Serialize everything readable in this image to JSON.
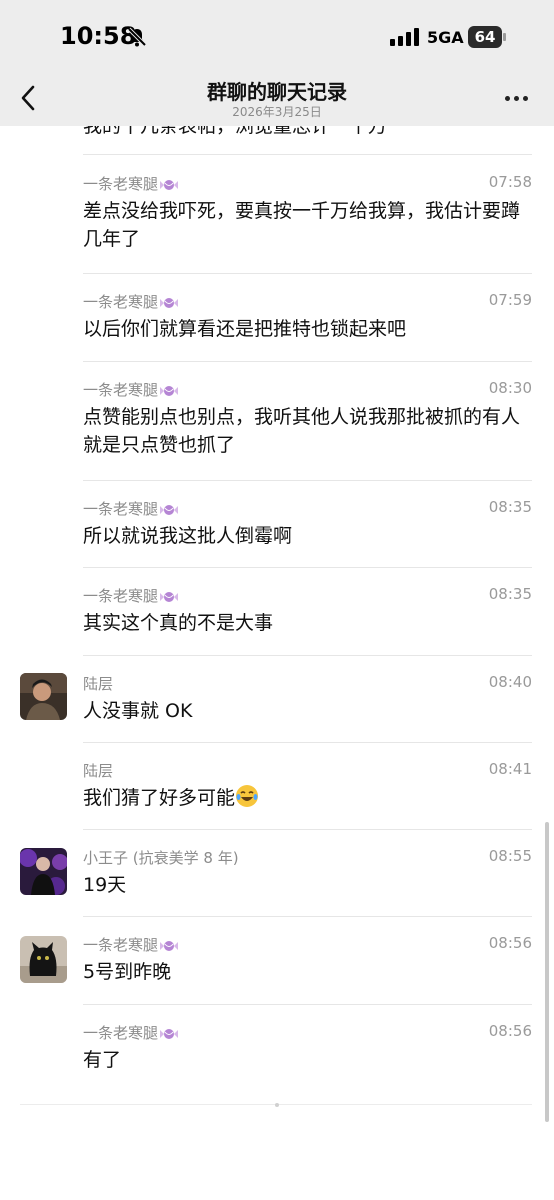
{
  "status_bar": {
    "time": "10:58",
    "network": "5GA",
    "battery": "64",
    "icons": [
      "bell-muted-icon",
      "signal-icon",
      "battery-icon"
    ]
  },
  "header": {
    "back_icon": "chevron-left-icon",
    "title": "群聊的聊天记录",
    "date": "2026年3月25日",
    "more_icon": "more-dots-icon"
  },
  "partial_top_text": "我的十几条表帖，浏览量总计一千万",
  "messages": [
    {
      "sender": "一条老寒腿",
      "time": "07:58",
      "text": "差点没给我吓死，要真按一千万给我算，我估计要蹲几年了",
      "avatar": ""
    },
    {
      "sender": "一条老寒腿",
      "time": "07:59",
      "text": "以后你们就算看还是把推特也锁起来吧",
      "avatar": ""
    },
    {
      "sender": "一条老寒腿",
      "time": "08:30",
      "text": "点赞能别点也别点，我听其他人说我那批被抓的有人就是只点赞也抓了",
      "avatar": ""
    },
    {
      "sender": "一条老寒腿",
      "time": "08:35",
      "text": "所以就说我这批人倒霉啊",
      "avatar": ""
    },
    {
      "sender": "一条老寒腿",
      "time": "08:35",
      "text": "其实这个真的不是大事",
      "avatar": ""
    },
    {
      "sender": "陆层",
      "time": "08:40",
      "text": "人没事就 OK",
      "avatar": "avatar-man-photo"
    },
    {
      "sender": "陆层",
      "time": "08:41",
      "text": "我们猜了好多可能",
      "avatar": "",
      "emoji": "laughing-tears-emoji"
    },
    {
      "sender": "小王子 (抗衰美学 8 年)",
      "time": "08:55",
      "text": "19天",
      "avatar": "avatar-purple-photo"
    },
    {
      "sender": "一条老寒腿",
      "time": "08:56",
      "text": "5号到昨晚",
      "avatar": "avatar-black-cat"
    },
    {
      "sender": "一条老寒腿",
      "time": "08:56",
      "text": "有了",
      "avatar": ""
    }
  ],
  "colors": {
    "header_bg": "#ededed",
    "page_bg": "#ffffff",
    "meta_text": "#8c8c8c",
    "divider": "#e6e6e6"
  }
}
